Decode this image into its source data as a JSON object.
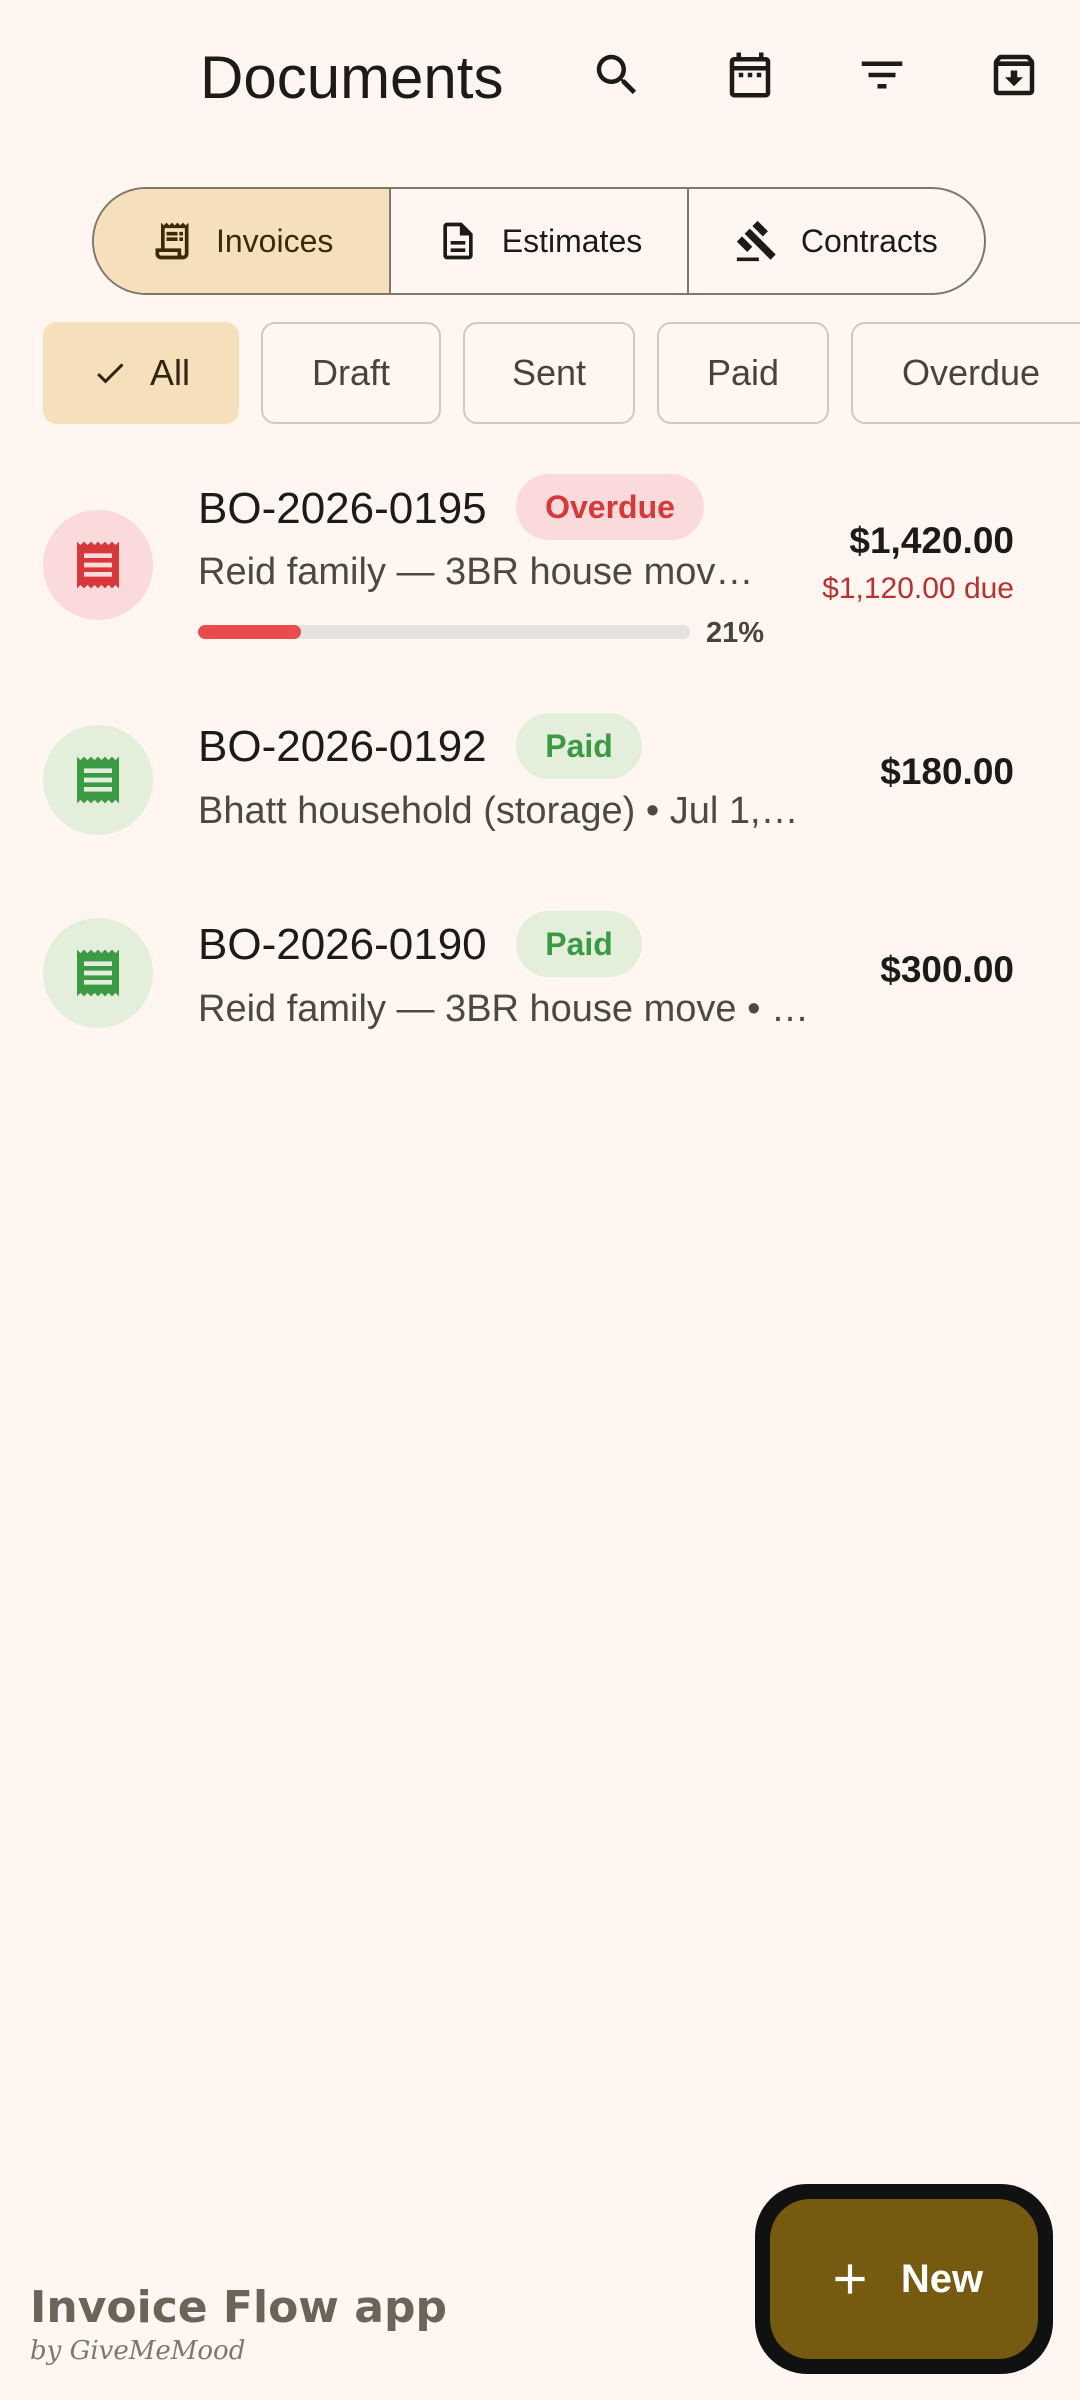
{
  "header": {
    "title": "Documents"
  },
  "tabs": [
    {
      "label": "Invoices",
      "icon": "receipt-icon",
      "selected": true
    },
    {
      "label": "Estimates",
      "icon": "document-icon",
      "selected": false
    },
    {
      "label": "Contracts",
      "icon": "gavel-icon",
      "selected": false
    }
  ],
  "filters": [
    {
      "label": "All",
      "selected": true
    },
    {
      "label": "Draft",
      "selected": false
    },
    {
      "label": "Sent",
      "selected": false
    },
    {
      "label": "Paid",
      "selected": false
    },
    {
      "label": "Overdue",
      "selected": false
    }
  ],
  "invoices": [
    {
      "number": "BO-2026-0195",
      "status": "Overdue",
      "subtitle": "Reid family — 3BR house mov…",
      "amount": "$1,420.00",
      "due": "$1,120.00 due",
      "progress_pct": 21,
      "progress_label": "21%"
    },
    {
      "number": "BO-2026-0192",
      "status": "Paid",
      "subtitle": "Bhatt household (storage) • Jul 1,…",
      "amount": "$180.00"
    },
    {
      "number": "BO-2026-0190",
      "status": "Paid",
      "subtitle": "Reid family — 3BR house move • …",
      "amount": "$300.00"
    }
  ],
  "fab": {
    "label": "New"
  },
  "branding": {
    "title": "Invoice Flow app",
    "subtitle": "by GiveMeMood"
  },
  "colors": {
    "background": "#fff6f1",
    "accent": "#765a10",
    "selected": "#f5e0bb",
    "overdue": "#d6383b",
    "paid": "#3c9a45"
  }
}
